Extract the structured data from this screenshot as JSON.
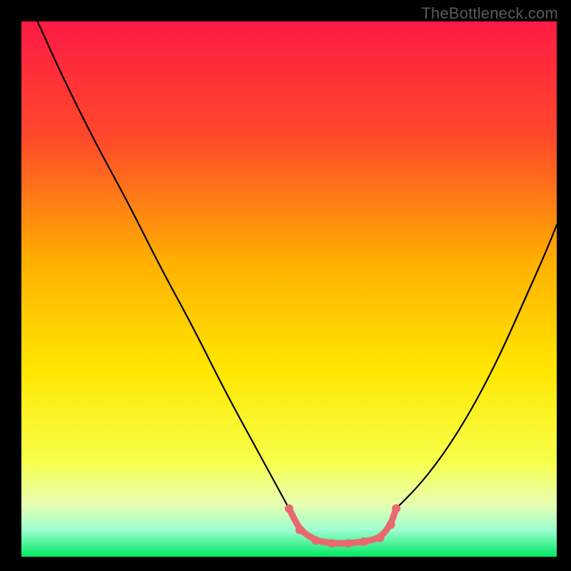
{
  "watermark": "TheBottleneck.com",
  "chart_data": {
    "type": "line",
    "title": "",
    "xlabel": "",
    "ylabel": "",
    "xlim": [
      0,
      100
    ],
    "ylim": [
      0,
      100
    ],
    "background_gradient": {
      "top": "#ff1a44",
      "upper_mid": "#ff8a00",
      "mid": "#ffe600",
      "lower_mid": "#f7ff4a",
      "bottom": "#00e864"
    },
    "series": [
      {
        "name": "left-curve",
        "color": "#000000",
        "x": [
          3,
          8,
          14,
          20,
          26,
          32,
          38,
          44,
          50
        ],
        "y": [
          100,
          89,
          77,
          66,
          54,
          43,
          31,
          20,
          9
        ]
      },
      {
        "name": "right-curve",
        "color": "#000000",
        "x": [
          70,
          74,
          78,
          82,
          86,
          90,
          94,
          98,
          100
        ],
        "y": [
          9,
          13,
          18,
          24,
          31,
          39,
          48,
          57,
          62
        ]
      },
      {
        "name": "valley-bottom",
        "color": "#e86a6f",
        "x": [
          50,
          52,
          55,
          58,
          61,
          64,
          67,
          69,
          70
        ],
        "y": [
          9,
          5,
          3,
          2.5,
          2.5,
          2.8,
          3.5,
          6,
          9
        ]
      }
    ],
    "markers": [
      {
        "x": 50,
        "y": 9,
        "color": "#e86a6f"
      },
      {
        "x": 52,
        "y": 5,
        "color": "#e86a6f"
      },
      {
        "x": 55,
        "y": 3,
        "color": "#e86a6f"
      },
      {
        "x": 58,
        "y": 2.5,
        "color": "#e86a6f"
      },
      {
        "x": 61,
        "y": 2.5,
        "color": "#e86a6f"
      },
      {
        "x": 64,
        "y": 2.8,
        "color": "#e86a6f"
      },
      {
        "x": 67,
        "y": 3.5,
        "color": "#e86a6f"
      },
      {
        "x": 69,
        "y": 6,
        "color": "#e86a6f"
      },
      {
        "x": 70,
        "y": 9,
        "color": "#e86a6f"
      }
    ]
  }
}
